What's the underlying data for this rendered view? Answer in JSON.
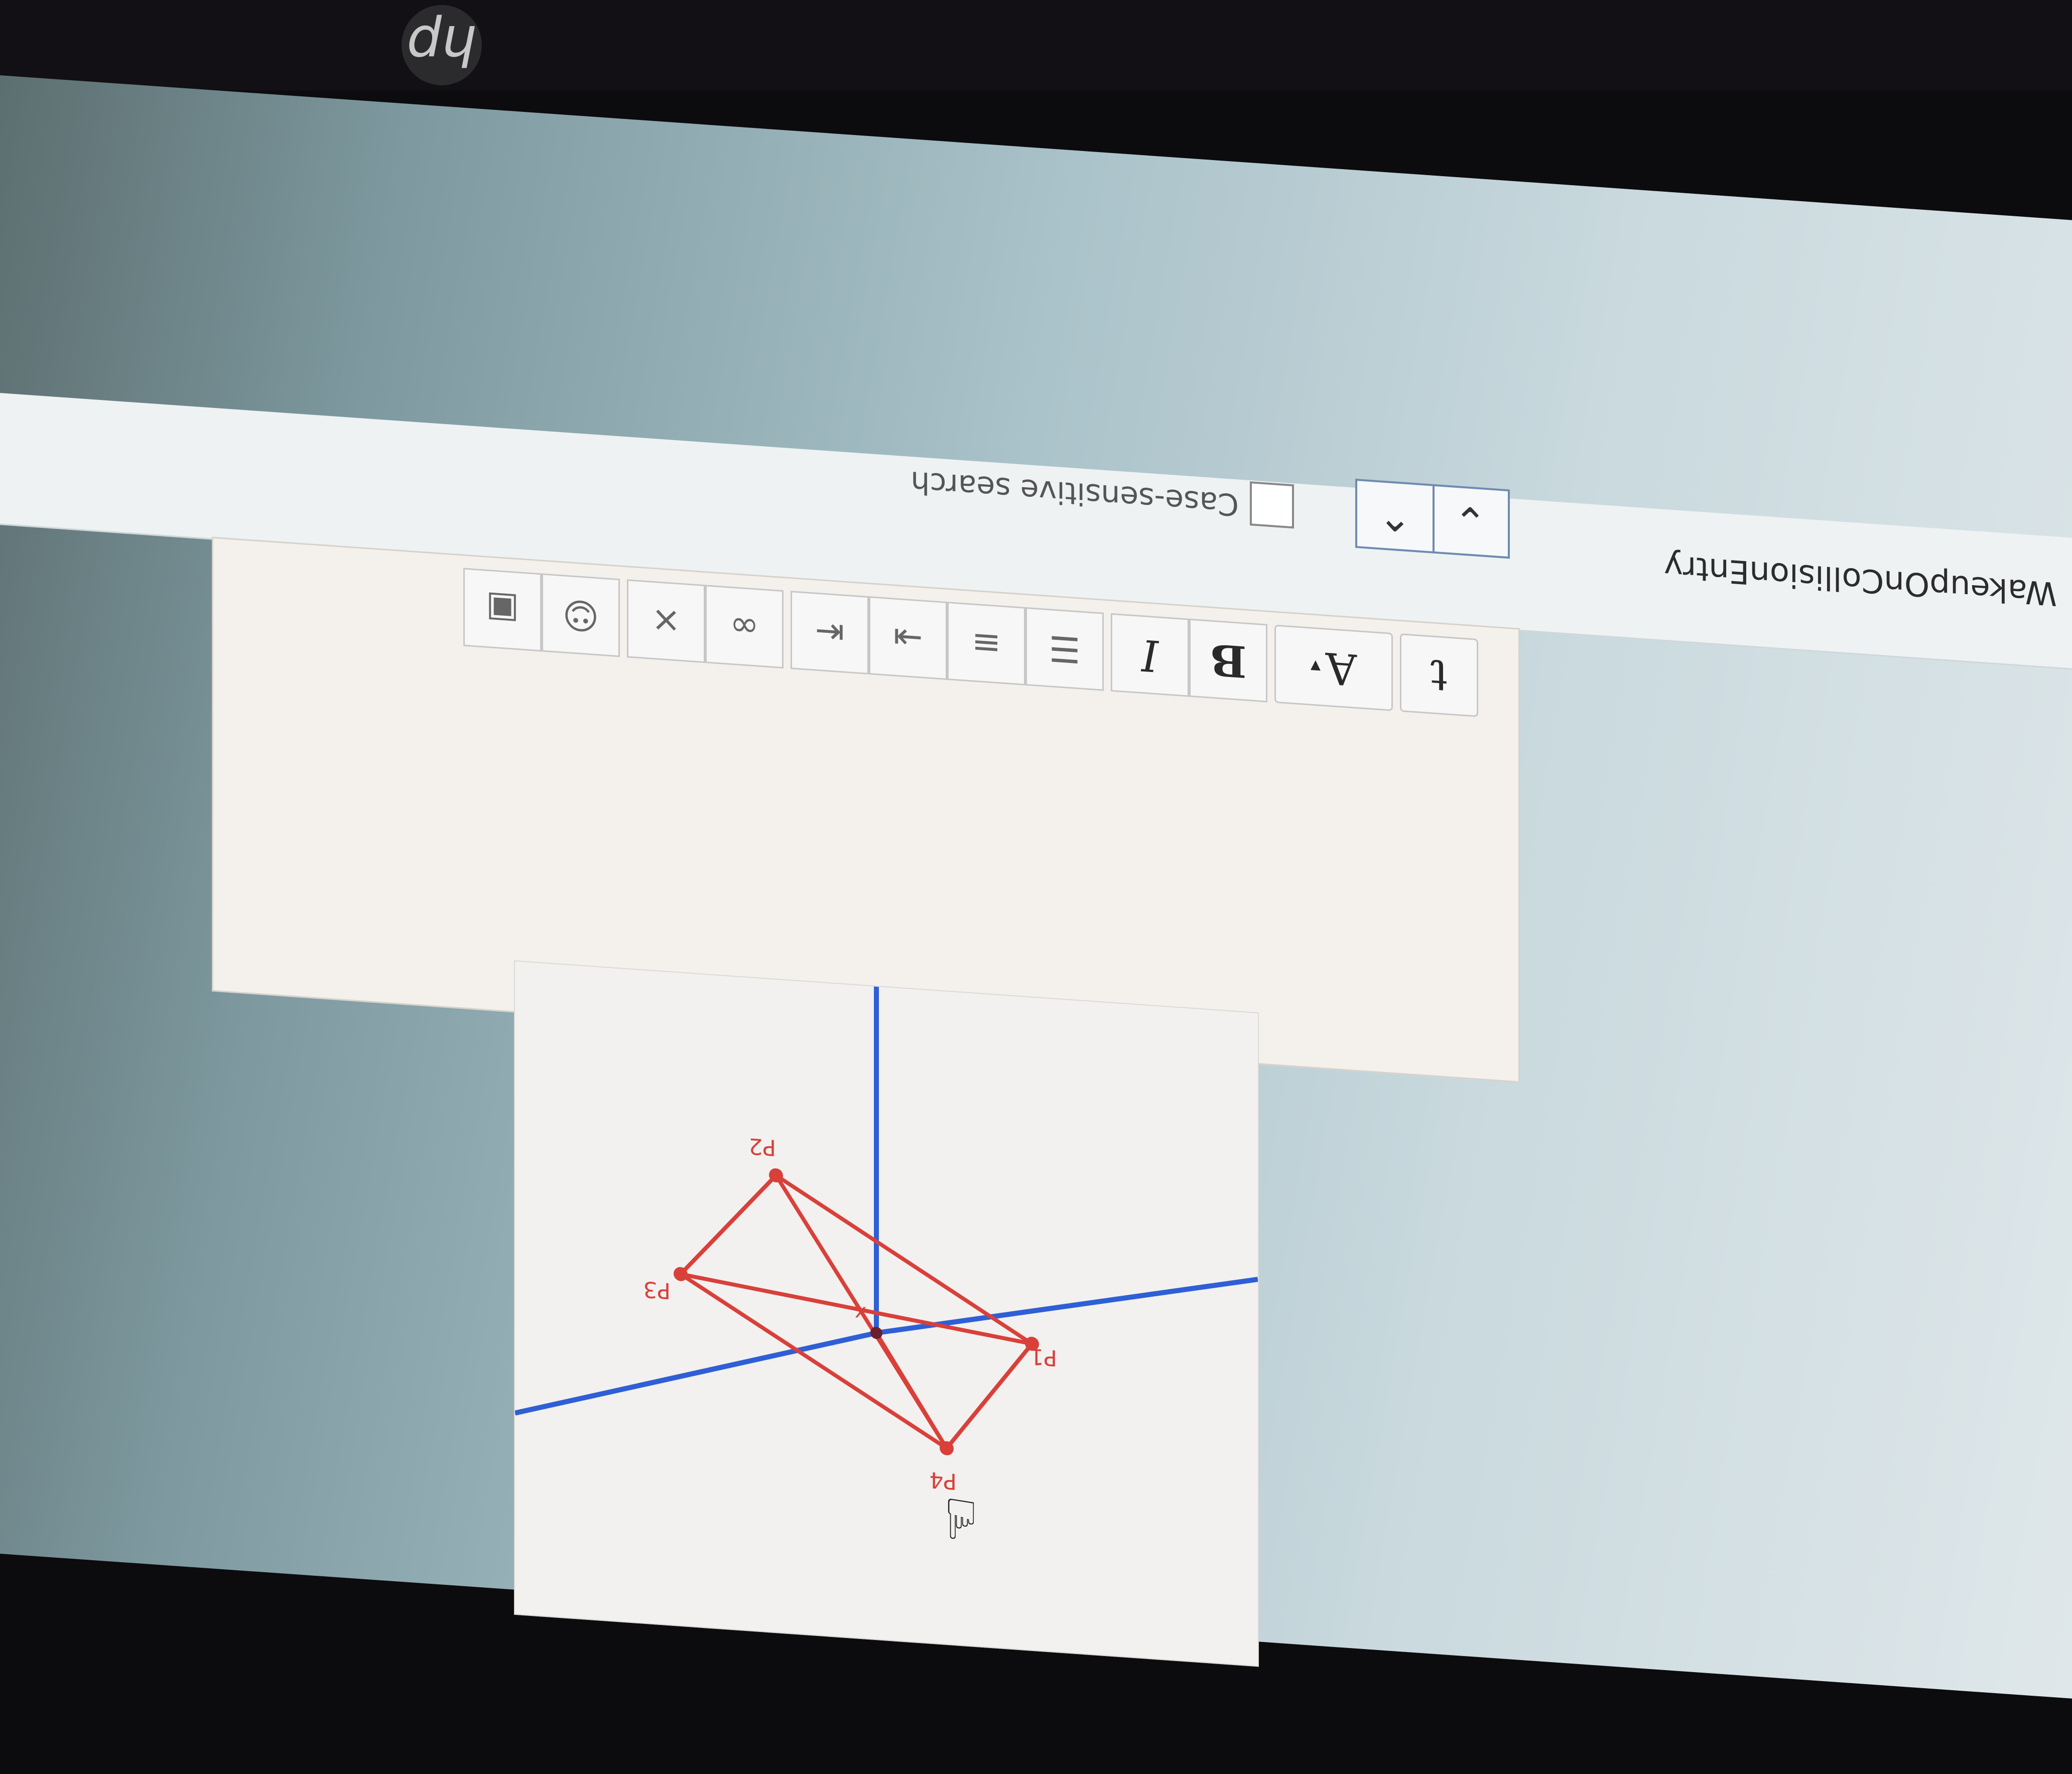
{
  "search": {
    "query": "WakeupOnCollisionEntry",
    "prev_icon": "chevron-up-icon",
    "next_icon": "chevron-down-icon",
    "case_sensitive_label": "Case-sensitive search"
  },
  "toolbar": {
    "buttons": [
      {
        "label": "t",
        "icon": "insert-text-icon"
      },
      {
        "label": "A",
        "icon": "text-style-dropdown-icon"
      },
      {
        "label": "B",
        "icon": "bold-icon"
      },
      {
        "label": "I",
        "icon": "italic-icon"
      },
      {
        "label": "",
        "icon": "unordered-list-icon"
      },
      {
        "label": "",
        "icon": "ordered-list-icon"
      },
      {
        "label": "",
        "icon": "indent-icon"
      },
      {
        "label": "",
        "icon": "outdent-icon"
      },
      {
        "label": "",
        "icon": "link-icon"
      },
      {
        "label": "",
        "icon": "unlink-icon"
      },
      {
        "label": "",
        "icon": "emoji-icon"
      },
      {
        "label": "",
        "icon": "image-icon"
      }
    ]
  },
  "diagram": {
    "points": [
      {
        "label": "P1"
      },
      {
        "label": "P2"
      },
      {
        "label": "P3"
      },
      {
        "label": "P4"
      },
      {
        "label": "x"
      }
    ],
    "colors": {
      "tetrahedron": "#d9403a",
      "axes": "#2f5fd6"
    }
  }
}
